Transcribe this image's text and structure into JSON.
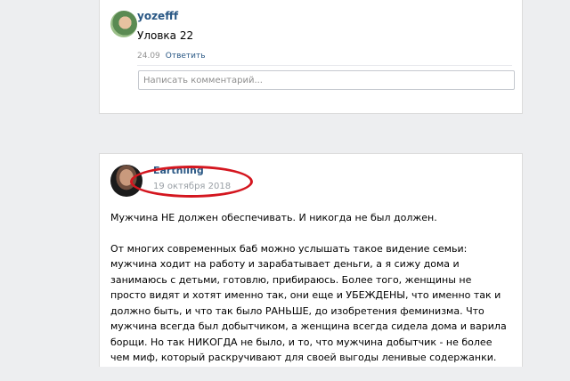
{
  "comment": {
    "author": "yozefff",
    "text": "Уловка 22",
    "date": "24.09",
    "reply_label": "Ответить",
    "input_placeholder": "Написать комментарий..."
  },
  "post": {
    "author": "Earthling",
    "date": "19 октября 2018",
    "paragraphs": [
      "Мужчина НЕ должен обеспечивать. И никогда не был должен.",
      "От многих современных баб можно услышать такое видение семьи: мужчина ходит на работу и зарабатывает деньги, а я сижу дома и занимаюсь с детьми, готовлю, прибираюсь. Более того, женщины не просто видят и хотят именно так, они еще и УБЕЖДЕНЫ, что именно так и должно быть, и что так было РАНЬШЕ, до изобретения феминизма. Что мужчина всегда был добытчиком, а женщина всегда сидела дома и варила борщи. Но так НИКОГДА не было, и то, что мужчина добытчик - не более чем миф, который раскручивают для своей выгоды ленивые содержанки."
    ]
  },
  "colors": {
    "link": "#2a5885",
    "annotation_circle": "#d4161f"
  }
}
